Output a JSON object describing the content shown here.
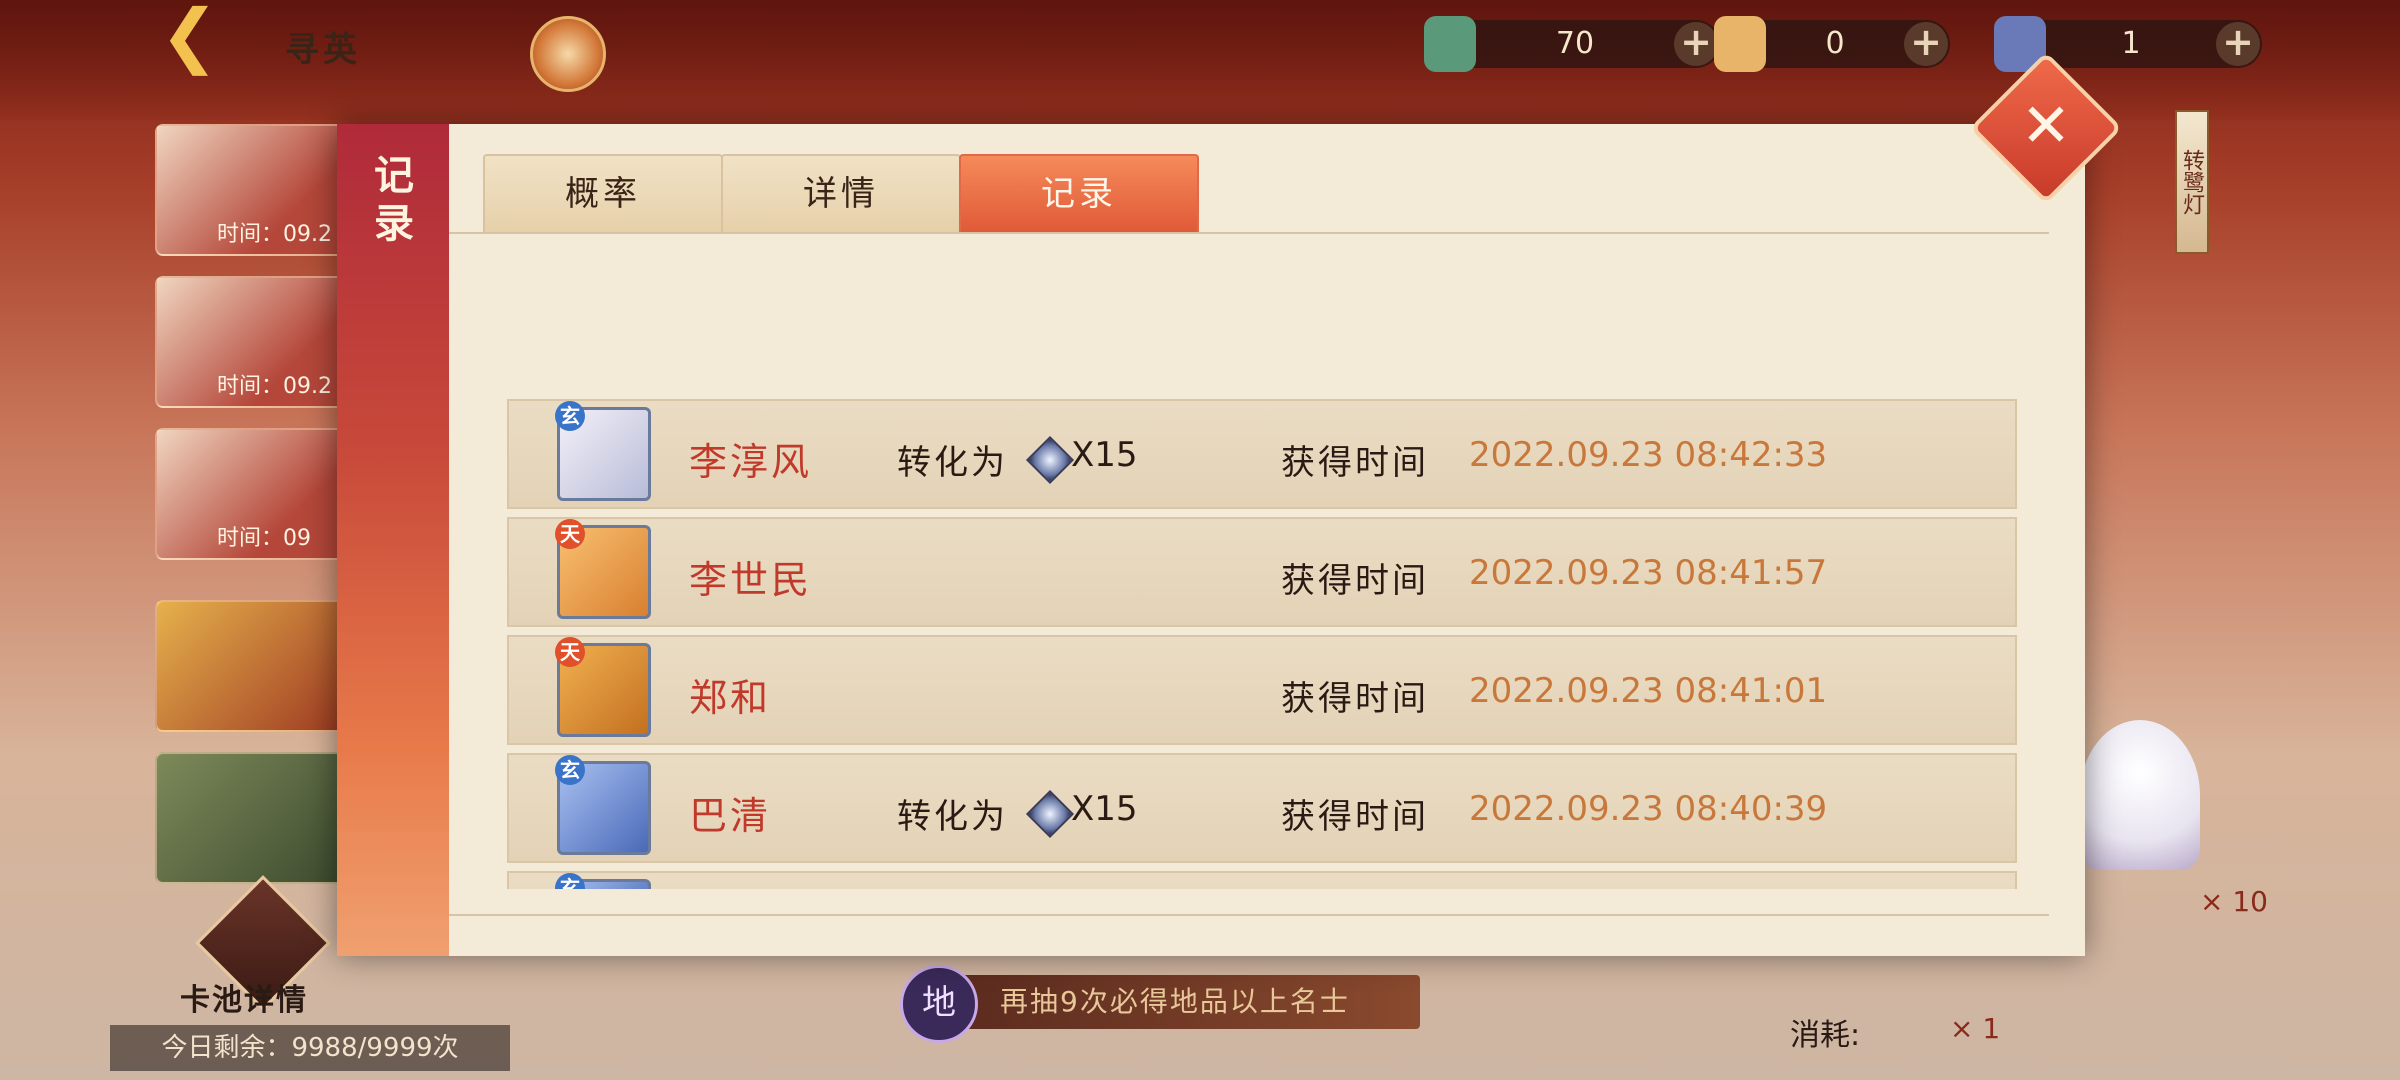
{
  "header": {
    "title": "寻英",
    "currencies": [
      {
        "icon": "jade-token-icon",
        "value": "70",
        "plus": "+"
      },
      {
        "icon": "fox-token-icon",
        "value": "0",
        "plus": "+"
      },
      {
        "icon": "cat-token-icon",
        "value": "1",
        "plus": "+"
      }
    ]
  },
  "background": {
    "banners": [
      {
        "time": "时间：09.2"
      },
      {
        "time": "时间：09.2"
      },
      {
        "time": "时间：09"
      }
    ],
    "card_pool_label": "卡池详情",
    "daily_remaining": "今日剩余：9988/9999次",
    "pity_badge": "地",
    "pity_text": "再抽9次必得地品以上名士",
    "cost_x10": "× 10",
    "consume_label": "消耗:",
    "consume_x1": "× 1",
    "lantern_text": "转鹭灯"
  },
  "modal": {
    "side_title": "记录",
    "close_label": "✕",
    "tabs": [
      {
        "label": "概率",
        "active": false
      },
      {
        "label": "详情",
        "active": false
      },
      {
        "label": "记录",
        "active": true
      }
    ],
    "records": [
      {
        "grade": "玄",
        "name": "李淳风",
        "convert_label": "转化为",
        "convert_qty": "X15",
        "time_label": "获得时间",
        "time": "2022.09.23  08:42:33"
      },
      {
        "grade": "天",
        "name": "李世民",
        "convert_label": "",
        "convert_qty": "",
        "time_label": "获得时间",
        "time": "2022.09.23  08:41:57"
      },
      {
        "grade": "天",
        "name": "郑和",
        "convert_label": "",
        "convert_qty": "",
        "time_label": "获得时间",
        "time": "2022.09.23  08:41:01"
      },
      {
        "grade": "玄",
        "name": "巴清",
        "convert_label": "转化为",
        "convert_qty": "X15",
        "time_label": "获得时间",
        "time": "2022.09.23  08:40:39"
      },
      {
        "grade": "玄",
        "name": "",
        "convert_label": "",
        "convert_qty": "",
        "time_label": "",
        "time": ""
      }
    ]
  },
  "colors": {
    "tab_active": "#e05a38",
    "name_red": "#c0392b",
    "time_orange": "#c8783a",
    "grade_xuan": "#3a74c8",
    "grade_tian": "#e0502a"
  }
}
